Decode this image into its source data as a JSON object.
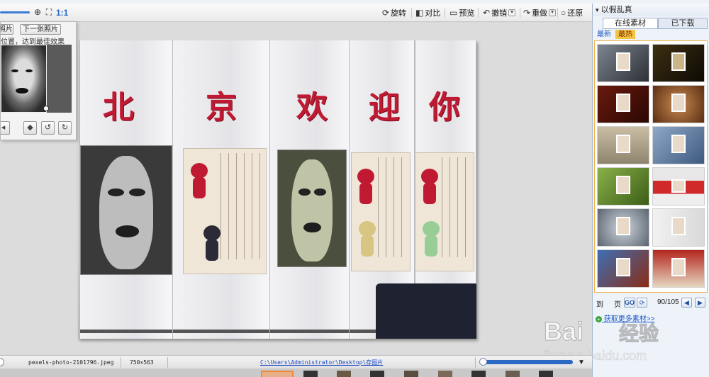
{
  "toolbar": {
    "ratio_label": "1:1",
    "rotate_label": "旋转",
    "compare_label": "对比",
    "preview_label": "预览",
    "undo_label": "撤销",
    "redo_label": "重做",
    "restore_label": "还原"
  },
  "float_panel": {
    "prev_label": "照片",
    "next_label": "下一张照片",
    "tip": "位置，达到最佳效果"
  },
  "photo": {
    "characters": [
      "北",
      "京",
      "欢",
      "迎",
      "你"
    ]
  },
  "right_panel": {
    "title": "以假乱真",
    "tabs": [
      {
        "label": "在线素材",
        "active": true
      },
      {
        "label": "已下载",
        "active": false
      }
    ],
    "subtabs": [
      {
        "label": "最新",
        "active": false
      },
      {
        "label": "最热",
        "active": true
      }
    ],
    "pager": {
      "prefix": "到",
      "page_suffix": "页",
      "go_label": "GO",
      "count": "90/105"
    },
    "more_link": "获取更多素材>>"
  },
  "status": {
    "filename": "pexels-photo-2101796.jpeg",
    "dimensions": "750×563",
    "path": "C:\\Users\\Administrator\\Desktop\\存图片"
  },
  "watermark": {
    "brand": "Bai",
    "brand_cn": "经验",
    "url": "jingyan.baidu.com"
  },
  "colors": {
    "accent": "#2b69c4",
    "red_text": "#c01a33",
    "active_subtab": "#f5c542"
  }
}
